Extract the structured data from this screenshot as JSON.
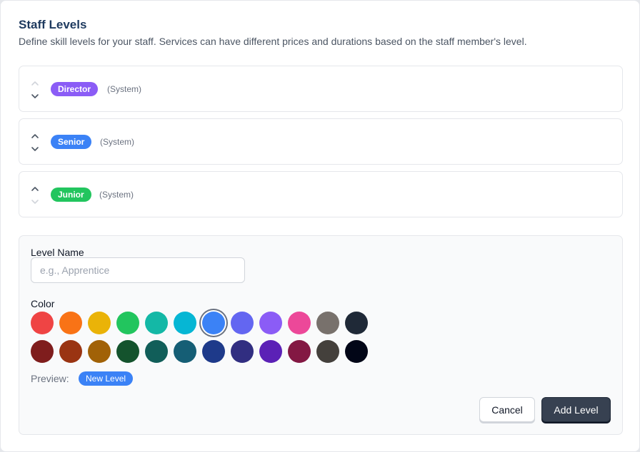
{
  "header": {
    "title": "Staff Levels",
    "subtitle": "Define skill levels for your staff. Services can have different prices and durations based on the staff member's level."
  },
  "levels": [
    {
      "name": "Director",
      "tag": "(System)",
      "color": "#8b5cf6",
      "can_move_up": false,
      "can_move_down": true
    },
    {
      "name": "Senior",
      "tag": "(System)",
      "color": "#3b82f6",
      "can_move_up": true,
      "can_move_down": true
    },
    {
      "name": "Junior",
      "tag": "(System)",
      "color": "#22c55e",
      "can_move_up": true,
      "can_move_down": false
    }
  ],
  "form": {
    "name_label": "Level Name",
    "name_placeholder": "e.g., Apprentice",
    "name_value": "",
    "color_label": "Color",
    "selected_color": "#3b82f6",
    "colors_row1": [
      "#ef4444",
      "#f97316",
      "#eab308",
      "#22c55e",
      "#14b8a6",
      "#06b6d4",
      "#3b82f6",
      "#6366f1",
      "#8b5cf6",
      "#ec4899",
      "#78716c",
      "#1f2937"
    ],
    "colors_row2": [
      "#7f1d1d",
      "#9a3412",
      "#a16207",
      "#14532d",
      "#115e59",
      "#155e75",
      "#1e3a8a",
      "#312e81",
      "#5b21b6",
      "#831843",
      "#44403c",
      "#020617"
    ],
    "preview_label": "Preview:",
    "preview_text": "New Level",
    "cancel_label": "Cancel",
    "add_label": "Add Level"
  }
}
